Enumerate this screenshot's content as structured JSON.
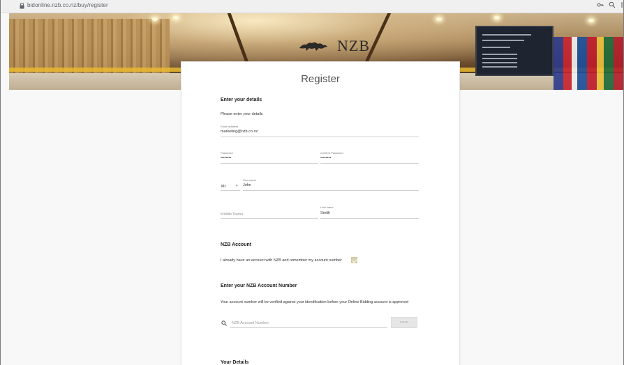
{
  "browser": {
    "url": "bidonline.nzb.co.nz/buy/register",
    "icons": [
      "lock-icon",
      "key-icon",
      "zoom-icon"
    ]
  },
  "hero": {
    "logo_text": "NZB"
  },
  "register": {
    "title": "Register",
    "enter_details_heading": "Enter your details",
    "enter_details_text": "Please enter your details",
    "email": {
      "label": "Email address",
      "value": "marketing@nzb.co.nz"
    },
    "password": {
      "label": "Password",
      "value": "••••••••"
    },
    "confirm_password": {
      "label": "Confirm Password",
      "value": "••••••••"
    },
    "title_select": {
      "value": "Mr",
      "arrow": "▾"
    },
    "first_name": {
      "label": "First name",
      "value": "John"
    },
    "middle_name": {
      "placeholder": "Middle Name"
    },
    "last_name": {
      "label": "Last name",
      "value": "Smith"
    },
    "nzb_account_heading": "NZB Account",
    "nzb_account_text": "I already have an account with NZB and remember my account number",
    "account_number_heading": "Enter your NZB Account Number",
    "account_number_text": "Your account number will be verified against your identification before your Online Bidding account is approved",
    "account_number_field": {
      "placeholder": "NZB Account Number"
    },
    "find_button": "FIND",
    "your_details_heading": "Your Details"
  },
  "colors": {
    "checkbox": "#d7d1ae",
    "card": "#ffffff",
    "background": "#f8f8f8"
  }
}
